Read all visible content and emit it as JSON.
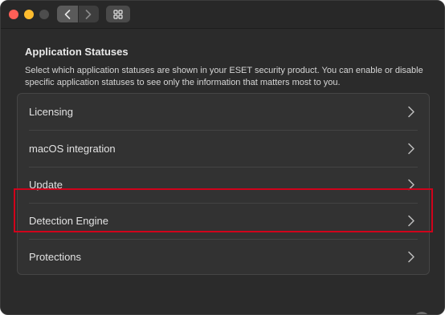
{
  "window": {
    "traffic_lights": [
      "close",
      "minimize",
      "maximize"
    ],
    "toolbar": {
      "back_icon": "chevron-left-icon",
      "forward_icon": "chevron-right-icon",
      "grid_icon": "grid-icon"
    }
  },
  "main": {
    "heading": "Application Statuses",
    "description": "Select which application statuses are shown in your ESET security product. You can enable or disable specific application statuses to see only the information that matters most to you.",
    "items": [
      {
        "label": "Licensing"
      },
      {
        "label": "macOS integration"
      },
      {
        "label": "Update"
      },
      {
        "label": "Detection Engine"
      },
      {
        "label": "Protections"
      }
    ],
    "help_label": "?"
  },
  "colors": {
    "highlight": "#d0021b",
    "close": "#ff5f57",
    "minimize": "#febc2e"
  }
}
